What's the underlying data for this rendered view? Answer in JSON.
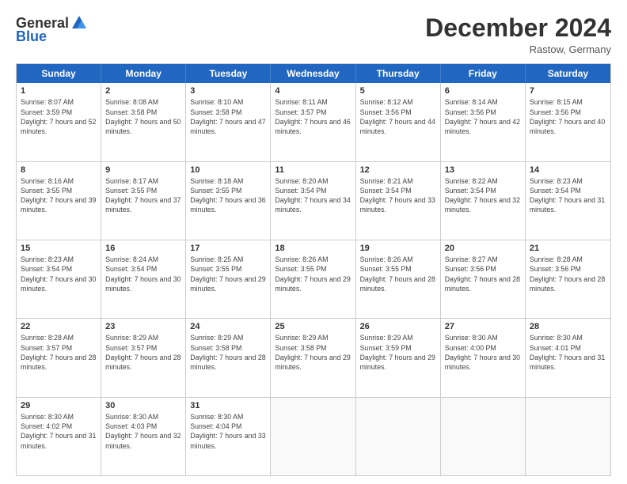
{
  "logo": {
    "general": "General",
    "blue": "Blue"
  },
  "title": "December 2024",
  "location": "Rastow, Germany",
  "days_of_week": [
    "Sunday",
    "Monday",
    "Tuesday",
    "Wednesday",
    "Thursday",
    "Friday",
    "Saturday"
  ],
  "weeks": [
    [
      {
        "day": "1",
        "sunrise": "8:07 AM",
        "sunset": "3:59 PM",
        "daylight": "7 hours and 52 minutes."
      },
      {
        "day": "2",
        "sunrise": "8:08 AM",
        "sunset": "3:58 PM",
        "daylight": "7 hours and 50 minutes."
      },
      {
        "day": "3",
        "sunrise": "8:10 AM",
        "sunset": "3:58 PM",
        "daylight": "7 hours and 47 minutes."
      },
      {
        "day": "4",
        "sunrise": "8:11 AM",
        "sunset": "3:57 PM",
        "daylight": "7 hours and 46 minutes."
      },
      {
        "day": "5",
        "sunrise": "8:12 AM",
        "sunset": "3:56 PM",
        "daylight": "7 hours and 44 minutes."
      },
      {
        "day": "6",
        "sunrise": "8:14 AM",
        "sunset": "3:56 PM",
        "daylight": "7 hours and 42 minutes."
      },
      {
        "day": "7",
        "sunrise": "8:15 AM",
        "sunset": "3:56 PM",
        "daylight": "7 hours and 40 minutes."
      }
    ],
    [
      {
        "day": "8",
        "sunrise": "8:16 AM",
        "sunset": "3:55 PM",
        "daylight": "7 hours and 39 minutes."
      },
      {
        "day": "9",
        "sunrise": "8:17 AM",
        "sunset": "3:55 PM",
        "daylight": "7 hours and 37 minutes."
      },
      {
        "day": "10",
        "sunrise": "8:18 AM",
        "sunset": "3:55 PM",
        "daylight": "7 hours and 36 minutes."
      },
      {
        "day": "11",
        "sunrise": "8:20 AM",
        "sunset": "3:54 PM",
        "daylight": "7 hours and 34 minutes."
      },
      {
        "day": "12",
        "sunrise": "8:21 AM",
        "sunset": "3:54 PM",
        "daylight": "7 hours and 33 minutes."
      },
      {
        "day": "13",
        "sunrise": "8:22 AM",
        "sunset": "3:54 PM",
        "daylight": "7 hours and 32 minutes."
      },
      {
        "day": "14",
        "sunrise": "8:23 AM",
        "sunset": "3:54 PM",
        "daylight": "7 hours and 31 minutes."
      }
    ],
    [
      {
        "day": "15",
        "sunrise": "8:23 AM",
        "sunset": "3:54 PM",
        "daylight": "7 hours and 30 minutes."
      },
      {
        "day": "16",
        "sunrise": "8:24 AM",
        "sunset": "3:54 PM",
        "daylight": "7 hours and 30 minutes."
      },
      {
        "day": "17",
        "sunrise": "8:25 AM",
        "sunset": "3:55 PM",
        "daylight": "7 hours and 29 minutes."
      },
      {
        "day": "18",
        "sunrise": "8:26 AM",
        "sunset": "3:55 PM",
        "daylight": "7 hours and 29 minutes."
      },
      {
        "day": "19",
        "sunrise": "8:26 AM",
        "sunset": "3:55 PM",
        "daylight": "7 hours and 28 minutes."
      },
      {
        "day": "20",
        "sunrise": "8:27 AM",
        "sunset": "3:56 PM",
        "daylight": "7 hours and 28 minutes."
      },
      {
        "day": "21",
        "sunrise": "8:28 AM",
        "sunset": "3:56 PM",
        "daylight": "7 hours and 28 minutes."
      }
    ],
    [
      {
        "day": "22",
        "sunrise": "8:28 AM",
        "sunset": "3:57 PM",
        "daylight": "7 hours and 28 minutes."
      },
      {
        "day": "23",
        "sunrise": "8:29 AM",
        "sunset": "3:57 PM",
        "daylight": "7 hours and 28 minutes."
      },
      {
        "day": "24",
        "sunrise": "8:29 AM",
        "sunset": "3:58 PM",
        "daylight": "7 hours and 28 minutes."
      },
      {
        "day": "25",
        "sunrise": "8:29 AM",
        "sunset": "3:58 PM",
        "daylight": "7 hours and 29 minutes."
      },
      {
        "day": "26",
        "sunrise": "8:29 AM",
        "sunset": "3:59 PM",
        "daylight": "7 hours and 29 minutes."
      },
      {
        "day": "27",
        "sunrise": "8:30 AM",
        "sunset": "4:00 PM",
        "daylight": "7 hours and 30 minutes."
      },
      {
        "day": "28",
        "sunrise": "8:30 AM",
        "sunset": "4:01 PM",
        "daylight": "7 hours and 31 minutes."
      }
    ],
    [
      {
        "day": "29",
        "sunrise": "8:30 AM",
        "sunset": "4:02 PM",
        "daylight": "7 hours and 31 minutes."
      },
      {
        "day": "30",
        "sunrise": "8:30 AM",
        "sunset": "4:03 PM",
        "daylight": "7 hours and 32 minutes."
      },
      {
        "day": "31",
        "sunrise": "8:30 AM",
        "sunset": "4:04 PM",
        "daylight": "7 hours and 33 minutes."
      },
      null,
      null,
      null,
      null
    ]
  ]
}
